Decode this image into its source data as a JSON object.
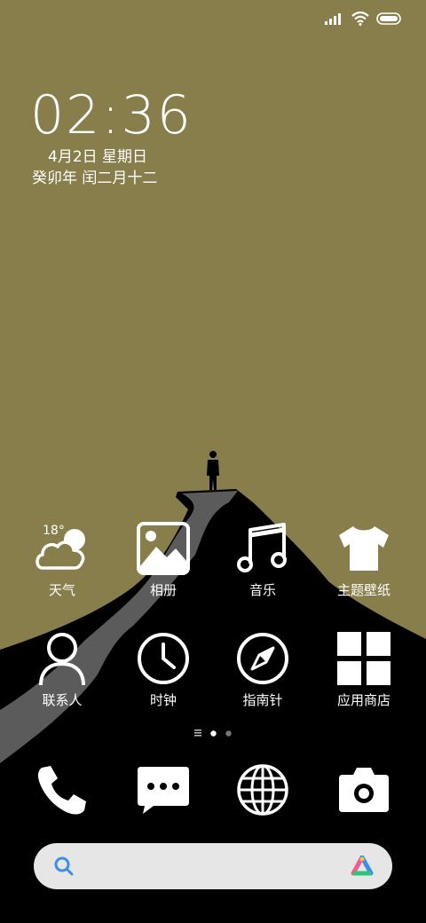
{
  "status_bar": {
    "icons": [
      "signal-icon",
      "wifi-icon",
      "battery-icon"
    ]
  },
  "lockscreen": {
    "time": "02:36",
    "date": "4月2日 星期日",
    "lunar": "癸卯年 闰二月十二"
  },
  "weather": {
    "temperature": "18°"
  },
  "apps": [
    {
      "label": "天气",
      "icon": "weather-cloud-icon"
    },
    {
      "label": "相册",
      "icon": "gallery-icon"
    },
    {
      "label": "音乐",
      "icon": "music-note-icon"
    },
    {
      "label": "主题壁纸",
      "icon": "tshirt-icon"
    },
    {
      "label": "联系人",
      "icon": "person-icon"
    },
    {
      "label": "时钟",
      "icon": "clock-icon"
    },
    {
      "label": "指南针",
      "icon": "compass-icon"
    },
    {
      "label": "应用商店",
      "icon": "app-store-grid-icon"
    }
  ],
  "page_indicator": {
    "pages": 2,
    "current": 1
  },
  "dock": [
    {
      "icon": "phone-icon"
    },
    {
      "icon": "messages-icon"
    },
    {
      "icon": "browser-globe-icon"
    },
    {
      "icon": "camera-icon"
    }
  ],
  "search_bar": {
    "icon": "search-icon",
    "assistant_icon": "assistant-logo-icon"
  },
  "colors": {
    "wallpaper": "#877e4b",
    "mountain": "#000000",
    "path": "#5a5a5a",
    "search_bg": "#e6e6e6",
    "search_icon": "#3d8ee8"
  }
}
